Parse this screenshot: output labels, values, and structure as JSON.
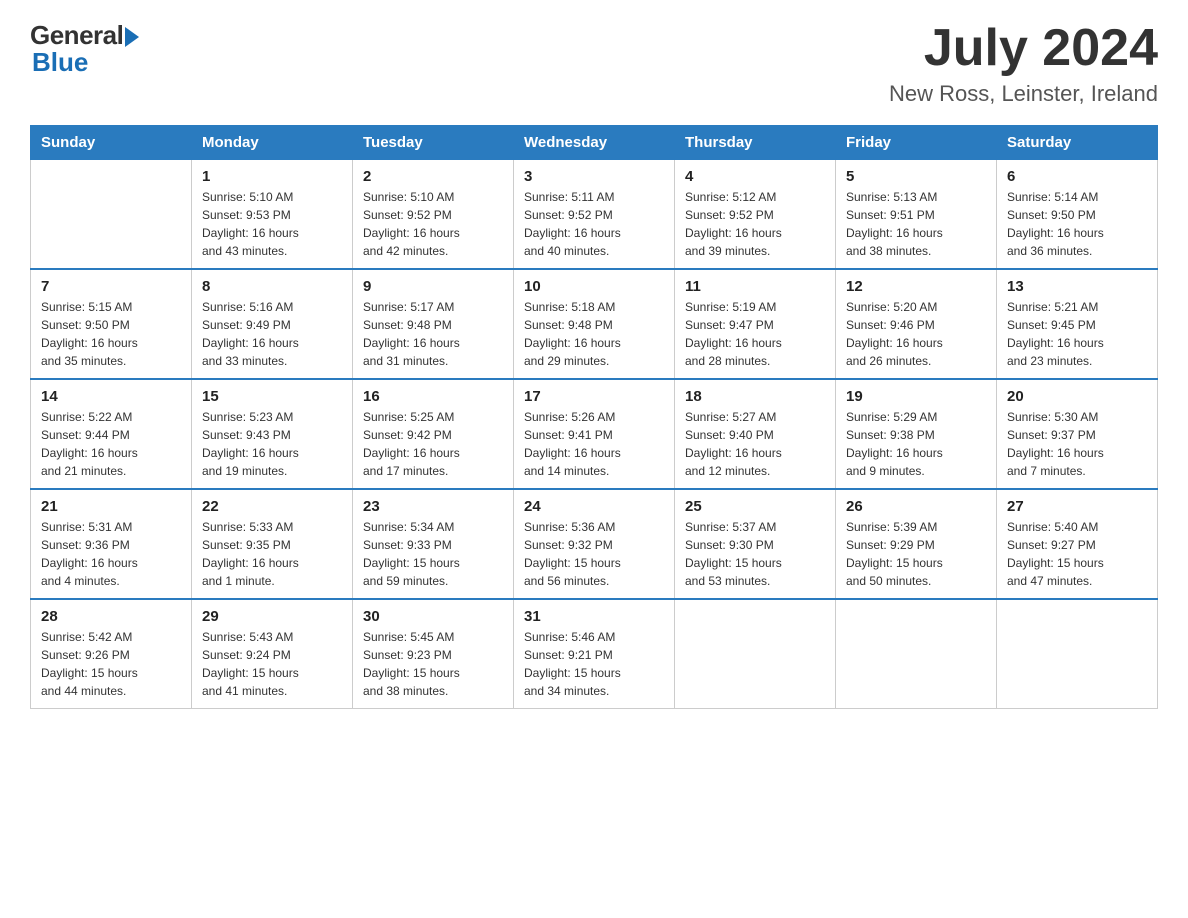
{
  "header": {
    "logo_general": "General",
    "logo_blue": "Blue",
    "month_year": "July 2024",
    "location": "New Ross, Leinster, Ireland"
  },
  "days_of_week": [
    "Sunday",
    "Monday",
    "Tuesday",
    "Wednesday",
    "Thursday",
    "Friday",
    "Saturday"
  ],
  "weeks": [
    [
      {
        "day": "",
        "info": ""
      },
      {
        "day": "1",
        "info": "Sunrise: 5:10 AM\nSunset: 9:53 PM\nDaylight: 16 hours\nand 43 minutes."
      },
      {
        "day": "2",
        "info": "Sunrise: 5:10 AM\nSunset: 9:52 PM\nDaylight: 16 hours\nand 42 minutes."
      },
      {
        "day": "3",
        "info": "Sunrise: 5:11 AM\nSunset: 9:52 PM\nDaylight: 16 hours\nand 40 minutes."
      },
      {
        "day": "4",
        "info": "Sunrise: 5:12 AM\nSunset: 9:52 PM\nDaylight: 16 hours\nand 39 minutes."
      },
      {
        "day": "5",
        "info": "Sunrise: 5:13 AM\nSunset: 9:51 PM\nDaylight: 16 hours\nand 38 minutes."
      },
      {
        "day": "6",
        "info": "Sunrise: 5:14 AM\nSunset: 9:50 PM\nDaylight: 16 hours\nand 36 minutes."
      }
    ],
    [
      {
        "day": "7",
        "info": "Sunrise: 5:15 AM\nSunset: 9:50 PM\nDaylight: 16 hours\nand 35 minutes."
      },
      {
        "day": "8",
        "info": "Sunrise: 5:16 AM\nSunset: 9:49 PM\nDaylight: 16 hours\nand 33 minutes."
      },
      {
        "day": "9",
        "info": "Sunrise: 5:17 AM\nSunset: 9:48 PM\nDaylight: 16 hours\nand 31 minutes."
      },
      {
        "day": "10",
        "info": "Sunrise: 5:18 AM\nSunset: 9:48 PM\nDaylight: 16 hours\nand 29 minutes."
      },
      {
        "day": "11",
        "info": "Sunrise: 5:19 AM\nSunset: 9:47 PM\nDaylight: 16 hours\nand 28 minutes."
      },
      {
        "day": "12",
        "info": "Sunrise: 5:20 AM\nSunset: 9:46 PM\nDaylight: 16 hours\nand 26 minutes."
      },
      {
        "day": "13",
        "info": "Sunrise: 5:21 AM\nSunset: 9:45 PM\nDaylight: 16 hours\nand 23 minutes."
      }
    ],
    [
      {
        "day": "14",
        "info": "Sunrise: 5:22 AM\nSunset: 9:44 PM\nDaylight: 16 hours\nand 21 minutes."
      },
      {
        "day": "15",
        "info": "Sunrise: 5:23 AM\nSunset: 9:43 PM\nDaylight: 16 hours\nand 19 minutes."
      },
      {
        "day": "16",
        "info": "Sunrise: 5:25 AM\nSunset: 9:42 PM\nDaylight: 16 hours\nand 17 minutes."
      },
      {
        "day": "17",
        "info": "Sunrise: 5:26 AM\nSunset: 9:41 PM\nDaylight: 16 hours\nand 14 minutes."
      },
      {
        "day": "18",
        "info": "Sunrise: 5:27 AM\nSunset: 9:40 PM\nDaylight: 16 hours\nand 12 minutes."
      },
      {
        "day": "19",
        "info": "Sunrise: 5:29 AM\nSunset: 9:38 PM\nDaylight: 16 hours\nand 9 minutes."
      },
      {
        "day": "20",
        "info": "Sunrise: 5:30 AM\nSunset: 9:37 PM\nDaylight: 16 hours\nand 7 minutes."
      }
    ],
    [
      {
        "day": "21",
        "info": "Sunrise: 5:31 AM\nSunset: 9:36 PM\nDaylight: 16 hours\nand 4 minutes."
      },
      {
        "day": "22",
        "info": "Sunrise: 5:33 AM\nSunset: 9:35 PM\nDaylight: 16 hours\nand 1 minute."
      },
      {
        "day": "23",
        "info": "Sunrise: 5:34 AM\nSunset: 9:33 PM\nDaylight: 15 hours\nand 59 minutes."
      },
      {
        "day": "24",
        "info": "Sunrise: 5:36 AM\nSunset: 9:32 PM\nDaylight: 15 hours\nand 56 minutes."
      },
      {
        "day": "25",
        "info": "Sunrise: 5:37 AM\nSunset: 9:30 PM\nDaylight: 15 hours\nand 53 minutes."
      },
      {
        "day": "26",
        "info": "Sunrise: 5:39 AM\nSunset: 9:29 PM\nDaylight: 15 hours\nand 50 minutes."
      },
      {
        "day": "27",
        "info": "Sunrise: 5:40 AM\nSunset: 9:27 PM\nDaylight: 15 hours\nand 47 minutes."
      }
    ],
    [
      {
        "day": "28",
        "info": "Sunrise: 5:42 AM\nSunset: 9:26 PM\nDaylight: 15 hours\nand 44 minutes."
      },
      {
        "day": "29",
        "info": "Sunrise: 5:43 AM\nSunset: 9:24 PM\nDaylight: 15 hours\nand 41 minutes."
      },
      {
        "day": "30",
        "info": "Sunrise: 5:45 AM\nSunset: 9:23 PM\nDaylight: 15 hours\nand 38 minutes."
      },
      {
        "day": "31",
        "info": "Sunrise: 5:46 AM\nSunset: 9:21 PM\nDaylight: 15 hours\nand 34 minutes."
      },
      {
        "day": "",
        "info": ""
      },
      {
        "day": "",
        "info": ""
      },
      {
        "day": "",
        "info": ""
      }
    ]
  ]
}
